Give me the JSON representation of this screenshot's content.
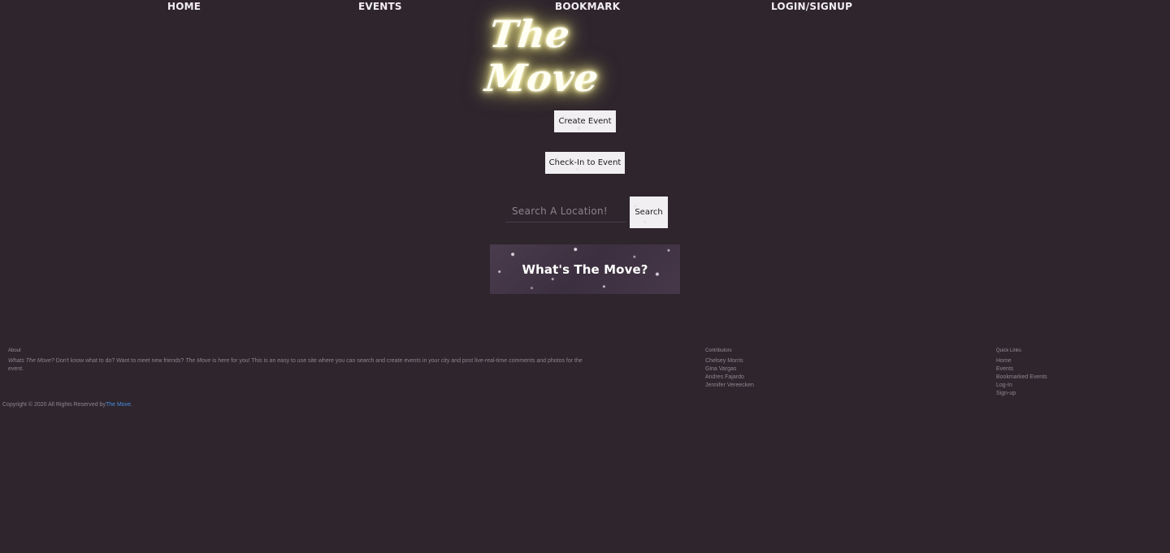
{
  "nav": {
    "home": "HOME",
    "events": "EVENTS",
    "bookmark": "BOOKMARK",
    "login": "LOGIN/SIGNUP"
  },
  "logo": {
    "text": "The Move"
  },
  "actions": {
    "create_event": "Create Event",
    "check_in": "Check-In to Event"
  },
  "search": {
    "placeholder": "Search A Location!",
    "value": "",
    "button_label": "Search"
  },
  "hero": {
    "title": "What's The Move?"
  },
  "footer": {
    "about": {
      "heading": "About",
      "brand_question": "Whats The Move?",
      "text_part1": " Don't know what to do? Want to meet new friends? ",
      "brand_name": "The Move",
      "text_part2": " is here for you! This is an easy to use site where you can search and create events in your city and post live-real-time comments and photos for the event."
    },
    "contributors": {
      "heading": "Contributors",
      "names": [
        "Chelsey Morris",
        "Gina Vargas",
        "Andres Fajardo",
        "Jennifer Vereecken"
      ]
    },
    "quick_links": {
      "heading": "Quick Links",
      "items": [
        "Home",
        "Events",
        "Bookmarked Events",
        "Log-In",
        "Sign-up"
      ]
    },
    "copyright": {
      "text": "Copyright © 2020 All Rights Reserved by",
      "link": "The Move",
      "suffix": "."
    }
  },
  "colors": {
    "background": "#2e252d",
    "logo_glow": "#fff7a8",
    "link_accent": "#4a8fe0"
  }
}
